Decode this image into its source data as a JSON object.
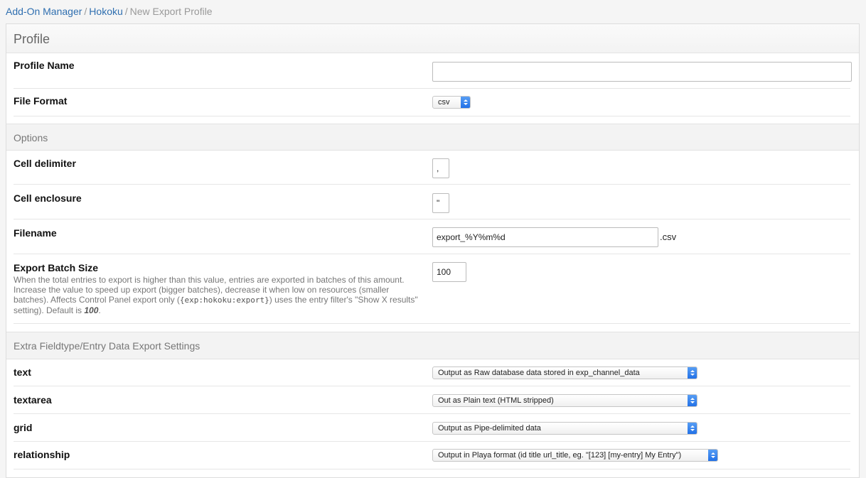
{
  "breadcrumb": {
    "items": [
      "Add-On Manager",
      "Hokoku"
    ],
    "separator": "/",
    "current": "New Export Profile"
  },
  "panel": {
    "title": "Profile"
  },
  "profile": {
    "name_label": "Profile Name",
    "name_value": "",
    "format_label": "File Format",
    "format_value": "csv"
  },
  "options": {
    "title": "Options",
    "cell_delimiter_label": "Cell delimiter",
    "cell_delimiter_value": ",",
    "cell_enclosure_label": "Cell enclosure",
    "cell_enclosure_value": "\"",
    "filename_label": "Filename",
    "filename_value": "export_%Y%m%d",
    "filename_suffix": ".csv",
    "batch_label": "Export Batch Size",
    "batch_desc_1": "When the total entries to export is higher than this value, entries are exported in batches of this amount. Increase the value to speed up export (bigger batches), decrease it when low on resources (smaller batches). Affects Control Panel export only (",
    "batch_desc_code": "{exp:hokoku:export}",
    "batch_desc_2": ") uses the entry filter's \"Show X results\" setting). Default is ",
    "batch_desc_default": "100",
    "batch_desc_end": ".",
    "batch_value": "100"
  },
  "extra": {
    "title": "Extra Fieldtype/Entry Data Export Settings",
    "text_label": "text",
    "text_value": "Output as Raw database data stored in exp_channel_data",
    "textarea_label": "textarea",
    "textarea_value": "Out as Plain text (HTML stripped)",
    "grid_label": "grid",
    "grid_value": "Output as Pipe-delimited data",
    "relationship_label": "relationship",
    "relationship_value": "Output in Playa format (id title url_title, eg. \"[123] [my-entry] My Entry\")"
  },
  "colors": {
    "link": "#2f6fb0",
    "select_arrow": "#1f6ee6"
  },
  "icons": {
    "select_arrows": "updown-chevron-icon"
  }
}
